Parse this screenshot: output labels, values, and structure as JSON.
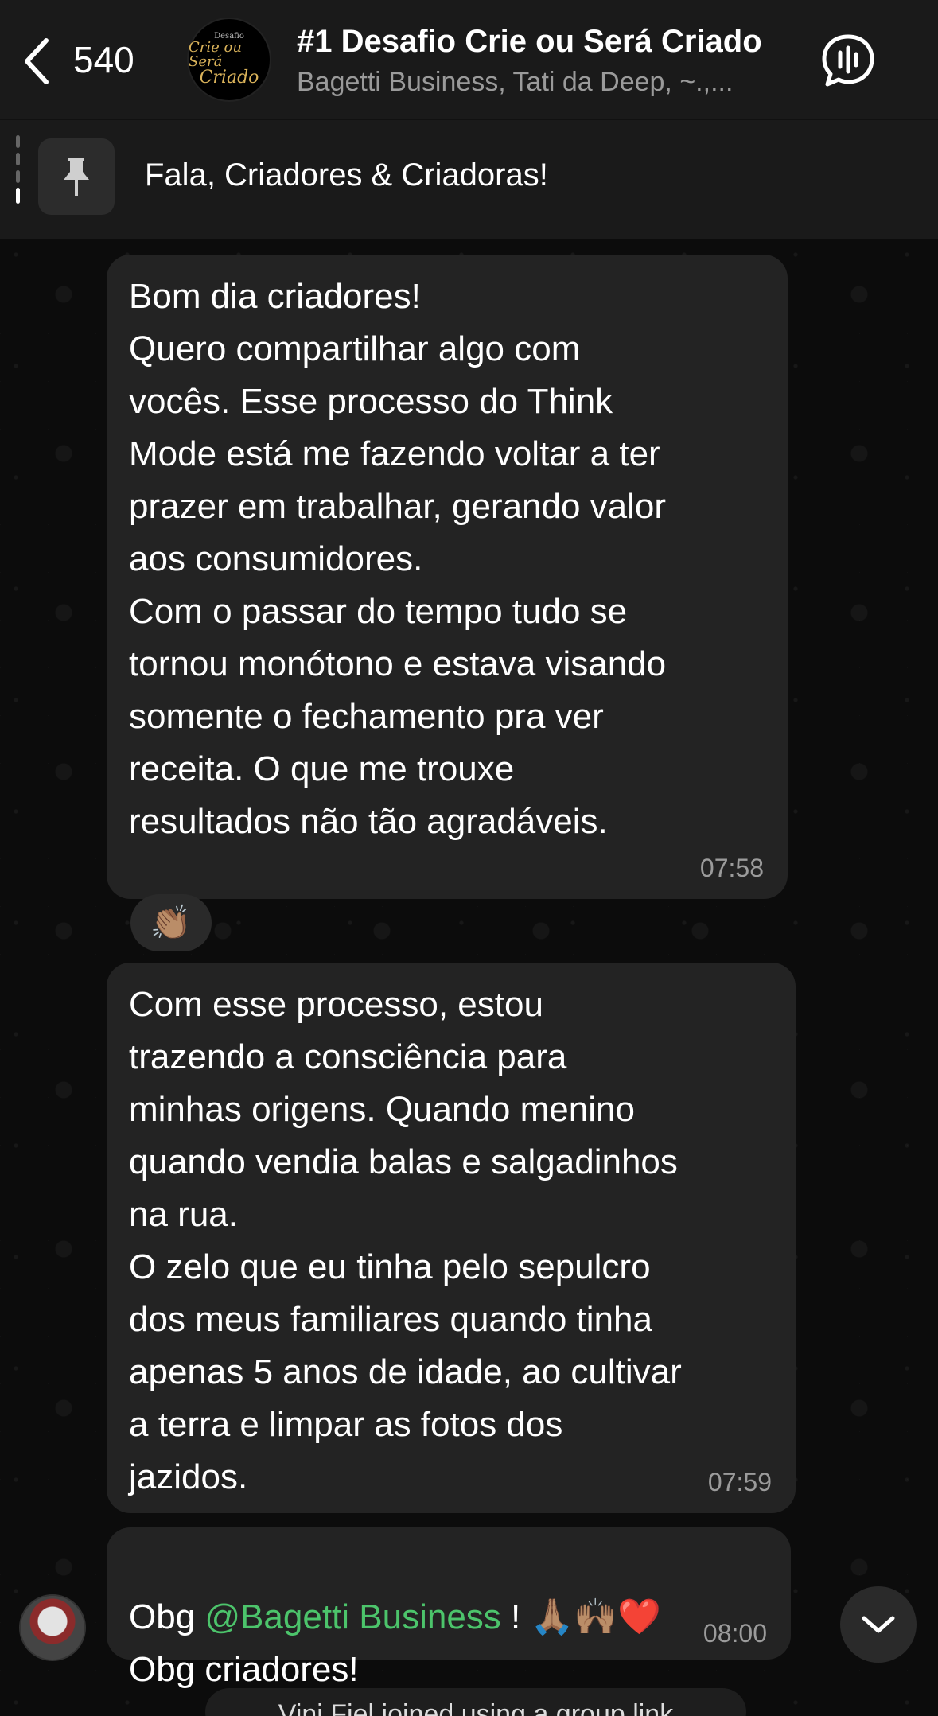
{
  "header": {
    "unread_count": "540",
    "title": "#1 Desafio Crie ou Será Criado",
    "members": "Bagetti Business, Tati da Deep, ~.,...",
    "avatar_lines": [
      "Desafio",
      "Crie ou Será",
      "Criado"
    ]
  },
  "pinned": {
    "text": "Fala, Criadores & Criadoras!"
  },
  "messages": [
    {
      "text": "Bom dia criadores!\nQuero compartilhar algo com\nvocês. Esse processo do Think\nMode está me fazendo voltar a ter\nprazer em trabalhar, gerando valor\naos consumidores.\nCom o passar do tempo tudo se\ntornou monótono e estava visando\nsomente o fechamento pra ver\nreceita. O que me trouxe\nresultados não tão agradáveis.",
      "time": "07:58",
      "reaction": "👏🏽"
    },
    {
      "text": "Com esse processo, estou\ntrazendo a consciência para\nminhas origens. Quando menino\nquando vendia balas e salgadinhos\nna rua.\nO zelo que eu tinha pelo sepulcro\ndos meus familiares quando tinha\napenas 5 anos de idade, ao cultivar\na terra e limpar as fotos dos\njazidos.",
      "time": "07:59"
    },
    {
      "prefix": "Obg ",
      "mention": "@Bagetti Business",
      "suffix": " ! 🙏🏽🙌🏽❤️",
      "line2": "Obg criadores!",
      "time": "08:00"
    }
  ],
  "system": {
    "text": "Vini Fiel joined using a group link"
  },
  "colors": {
    "bubble": "#232323",
    "mention": "#4cc46b",
    "header": "#1a1a1a"
  }
}
